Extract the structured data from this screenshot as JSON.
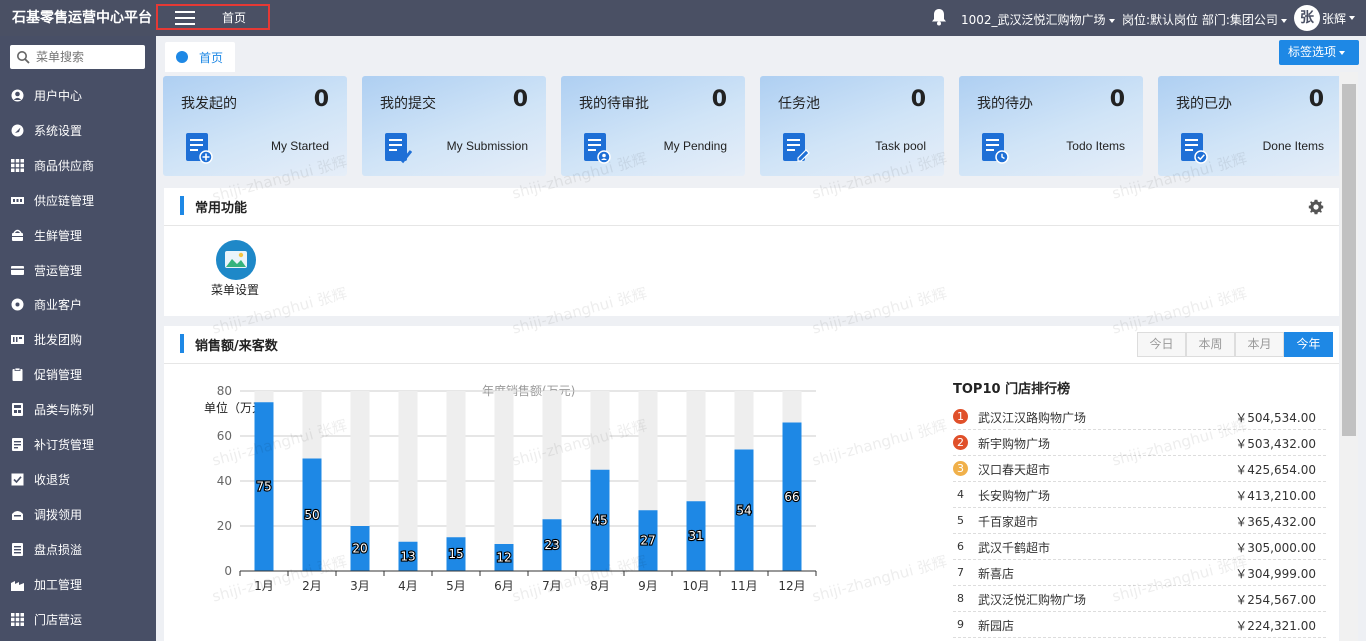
{
  "header": {
    "brand": "石基零售运营中心平台",
    "home_link": "首页",
    "store": "1002_武汉泛悦汇购物广场",
    "post": "岗位:默认岗位 部门:集团公司",
    "avatar_char": "张",
    "username": "张辉"
  },
  "sidebar": {
    "search_placeholder": "菜单搜索",
    "items": [
      {
        "label": "用户中心",
        "icon": "user-icon"
      },
      {
        "label": "系统设置",
        "icon": "settings-icon"
      },
      {
        "label": "商品供应商",
        "icon": "grid-icon"
      },
      {
        "label": "供应链管理",
        "icon": "chain-icon"
      },
      {
        "label": "生鲜管理",
        "icon": "basket-icon"
      },
      {
        "label": "营运管理",
        "icon": "card-icon"
      },
      {
        "label": "商业客户",
        "icon": "disc-icon"
      },
      {
        "label": "批发团购",
        "icon": "wholesale-icon"
      },
      {
        "label": "促销管理",
        "icon": "clipboard-icon"
      },
      {
        "label": "品类与陈列",
        "icon": "display-icon"
      },
      {
        "label": "补订货管理",
        "icon": "order-icon"
      },
      {
        "label": "收退货",
        "icon": "check-icon"
      },
      {
        "label": "调拨领用",
        "icon": "transfer-icon"
      },
      {
        "label": "盘点损溢",
        "icon": "list-icon"
      },
      {
        "label": "加工管理",
        "icon": "factory-icon"
      },
      {
        "label": "门店营运",
        "icon": "store-icon"
      }
    ]
  },
  "tabs": {
    "home": "首页",
    "options": "标签选项"
  },
  "cards": [
    {
      "title": "我发起的",
      "count": "0",
      "sub": "My Started",
      "icon": "doc-add-icon"
    },
    {
      "title": "我的提交",
      "count": "0",
      "sub": "My Submission",
      "icon": "doc-check-icon"
    },
    {
      "title": "我的待审批",
      "count": "0",
      "sub": "My Pending",
      "icon": "doc-user-icon"
    },
    {
      "title": "任务池",
      "count": "0",
      "sub": "Task pool",
      "icon": "doc-edit-icon"
    },
    {
      "title": "我的待办",
      "count": "0",
      "sub": "Todo Items",
      "icon": "doc-clock-icon"
    },
    {
      "title": "我的已办",
      "count": "0",
      "sub": "Done Items",
      "icon": "doc-done-icon"
    }
  ],
  "common": {
    "title": "常用功能",
    "menu_setting": "菜单设置"
  },
  "sales": {
    "title": "销售额/来客数",
    "ranges": [
      "今日",
      "本周",
      "本月",
      "今年"
    ],
    "active_range": "今年",
    "chart_title": "年度销售额(万元)",
    "unit_label": "单位（万元）",
    "rank_title": "TOP10 门店排行榜",
    "ranking": [
      {
        "no": "1",
        "name": "武汉江汉路购物广场",
        "value": "￥504,534.00"
      },
      {
        "no": "2",
        "name": "新宇购物广场",
        "value": "￥503,432.00"
      },
      {
        "no": "3",
        "name": "汉口春天超市",
        "value": "￥425,654.00"
      },
      {
        "no": "4",
        "name": "长安购物广场",
        "value": "￥413,210.00"
      },
      {
        "no": "5",
        "name": "千百家超市",
        "value": "￥365,432.00"
      },
      {
        "no": "6",
        "name": "武汉千鹤超市",
        "value": "￥305,000.00"
      },
      {
        "no": "7",
        "name": "新喜店",
        "value": "￥304,999.00"
      },
      {
        "no": "8",
        "name": "武汉泛悦汇购物广场",
        "value": "￥254,567.00"
      },
      {
        "no": "9",
        "name": "新园店",
        "value": "￥224,321.00"
      }
    ],
    "rank_colors": [
      "#e0502a",
      "#e0502a",
      "#f0b04a"
    ]
  },
  "watermark": "shiji-zhanghui 张辉",
  "chart_data": {
    "type": "bar",
    "title": "年度销售额(万元)",
    "ylabel": "单位（万元）",
    "categories": [
      "1月",
      "2月",
      "3月",
      "4月",
      "5月",
      "6月",
      "7月",
      "8月",
      "9月",
      "10月",
      "11月",
      "12月"
    ],
    "values": [
      75,
      50,
      20,
      13,
      15,
      12,
      23,
      45,
      27,
      31,
      54,
      66
    ],
    "ylim": [
      0,
      80
    ],
    "yticks": [
      0,
      20,
      40,
      60,
      80
    ],
    "grid": true,
    "bar_color": "#1e88e5",
    "background_bar_color": "#eeeeee"
  }
}
